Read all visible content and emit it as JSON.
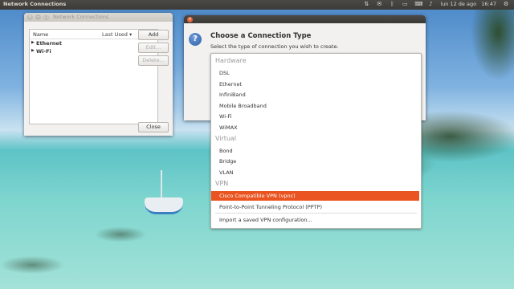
{
  "topbar": {
    "app_name": "Network Connections",
    "tray_icons": [
      "network-icon",
      "mail-icon",
      "bluetooth-icon",
      "battery-icon",
      "keyboard-icon",
      "volume-icon"
    ],
    "clock": "lun 12 de ago   16:47",
    "power_icon": "gear-icon"
  },
  "network_window": {
    "title": "Network Connections",
    "list_header": {
      "name": "Name",
      "sort": "Last Used ▾"
    },
    "connections": [
      {
        "label": "Ethernet"
      },
      {
        "label": "Wi-Fi"
      }
    ],
    "buttons": {
      "add": "Add",
      "edit": "Edit...",
      "delete": "Delete...",
      "close": "Close"
    }
  },
  "dialog": {
    "heading": "Choose a Connection Type",
    "subtitle": "Select the type of connection you wish to create.",
    "sections": {
      "hardware": "Hardware",
      "virtual": "Virtual",
      "vpn": "VPN"
    },
    "hardware_items": [
      "DSL",
      "Ethernet",
      "InfiniBand",
      "Mobile Broadband",
      "Wi-Fi",
      "WiMAX"
    ],
    "virtual_items": [
      "Bond",
      "Bridge",
      "VLAN"
    ],
    "vpn_selected": "Cisco Compatible VPN (vpnc)",
    "vpn_pptp": "Point-to-Point Tunneling Protocol (PPTP)",
    "import": "Import a saved VPN configuration...",
    "accent": "#e95420"
  }
}
